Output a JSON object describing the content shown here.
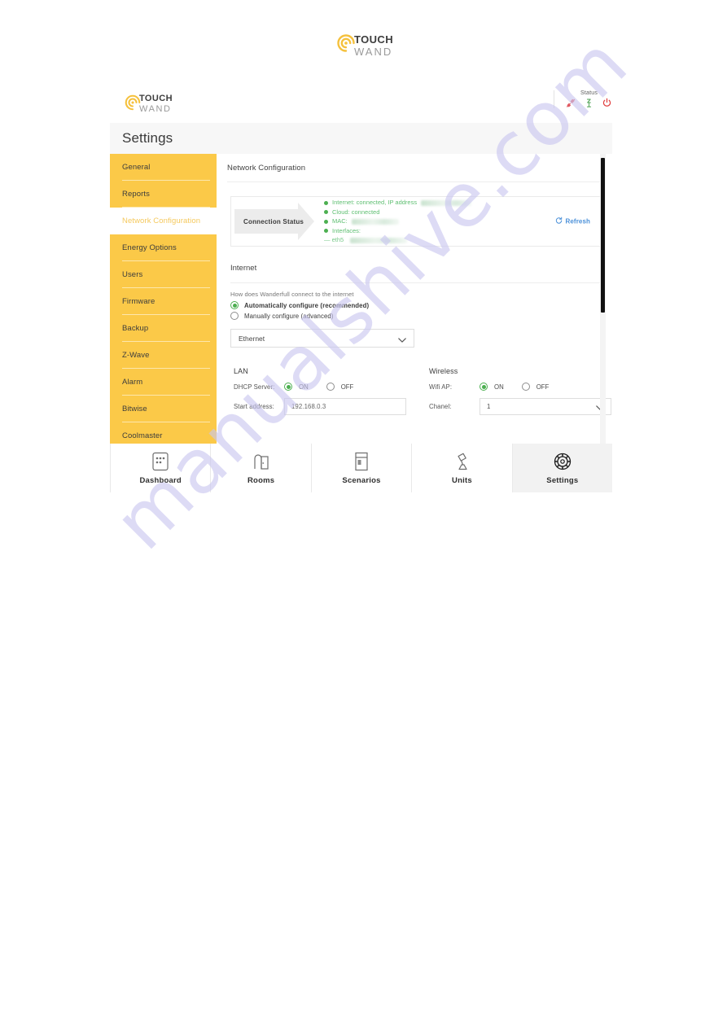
{
  "brand": {
    "name_line1": "TOUCH",
    "name_line2": "WAND",
    "logo_color": "#f5c13d",
    "spiral_icon": "touchwand-spiral-logo"
  },
  "header": {
    "status_label": "Status",
    "icons": [
      {
        "name": "plug-disconnected-icon",
        "color": "#e05a62"
      },
      {
        "name": "zwave-antenna-icon",
        "color": "#5aa85f"
      },
      {
        "name": "power-icon",
        "color": "#e03b3b"
      }
    ]
  },
  "page": {
    "title": "Settings"
  },
  "sidebar": {
    "active_index": 2,
    "items": [
      {
        "label": "General"
      },
      {
        "label": "Reports"
      },
      {
        "label": "Network Configuration"
      },
      {
        "label": "Energy Options"
      },
      {
        "label": "Users"
      },
      {
        "label": "Firmware"
      },
      {
        "label": "Backup"
      },
      {
        "label": "Z-Wave"
      },
      {
        "label": "Alarm"
      },
      {
        "label": "Bitwise"
      },
      {
        "label": "Coolmaster"
      }
    ]
  },
  "content": {
    "section_title": "Network Configuration",
    "connection_status": {
      "label": "Connection Status",
      "refresh_label": "Refresh",
      "refresh_icon": "refresh-circular-arrows-icon",
      "accent_color": "#4caf50",
      "refresh_color": "#4a90d9",
      "lines": [
        {
          "text": "Internet: connected, IP address",
          "redacted": true,
          "redacted_width": 62
        },
        {
          "text": "Cloud: connected",
          "redacted": false
        },
        {
          "text": "MAC:",
          "redacted": true,
          "redacted_width": 58
        },
        {
          "text": "Interfaces:",
          "redacted": false
        }
      ],
      "sub_line": {
        "prefix": "— eth5",
        "redacted": true,
        "redacted_width": 70
      }
    },
    "internet": {
      "title": "Internet",
      "question": "How does Wanderfull connect to the internet",
      "options": [
        {
          "label": "Automatically configure (recommended)",
          "selected": true
        },
        {
          "label": "Manually configure (advanced)",
          "selected": false
        }
      ],
      "connection_type_select": {
        "value": "Ethernet",
        "chevron_icon": "chevron-down-icon"
      }
    },
    "lan": {
      "title": "LAN",
      "dhcp_label": "DHCP Server:",
      "dhcp_on_label": "ON",
      "dhcp_off_label": "OFF",
      "dhcp_value": "ON",
      "start_address_label": "Start address:",
      "start_address_value": "192.168.0.3"
    },
    "wireless": {
      "title": "Wireless",
      "wifi_ap_label": "Wifi AP:",
      "wifi_on_label": "ON",
      "wifi_off_label": "OFF",
      "wifi_value": "ON",
      "channel_label": "Chanel:",
      "channel_value": "1",
      "chevron_icon": "chevron-down-icon"
    }
  },
  "bottom_nav": {
    "active_index": 4,
    "items": [
      {
        "label": "Dashboard",
        "icon": "dashboard-grid-icon"
      },
      {
        "label": "Rooms",
        "icon": "rooms-door-icon"
      },
      {
        "label": "Scenarios",
        "icon": "scenarios-panel-icon"
      },
      {
        "label": "Units",
        "icon": "units-lamp-icon"
      },
      {
        "label": "Settings",
        "icon": "settings-gear-icon"
      }
    ]
  },
  "watermark": {
    "text": "manualshive.com",
    "color": "#c9c6f0"
  }
}
